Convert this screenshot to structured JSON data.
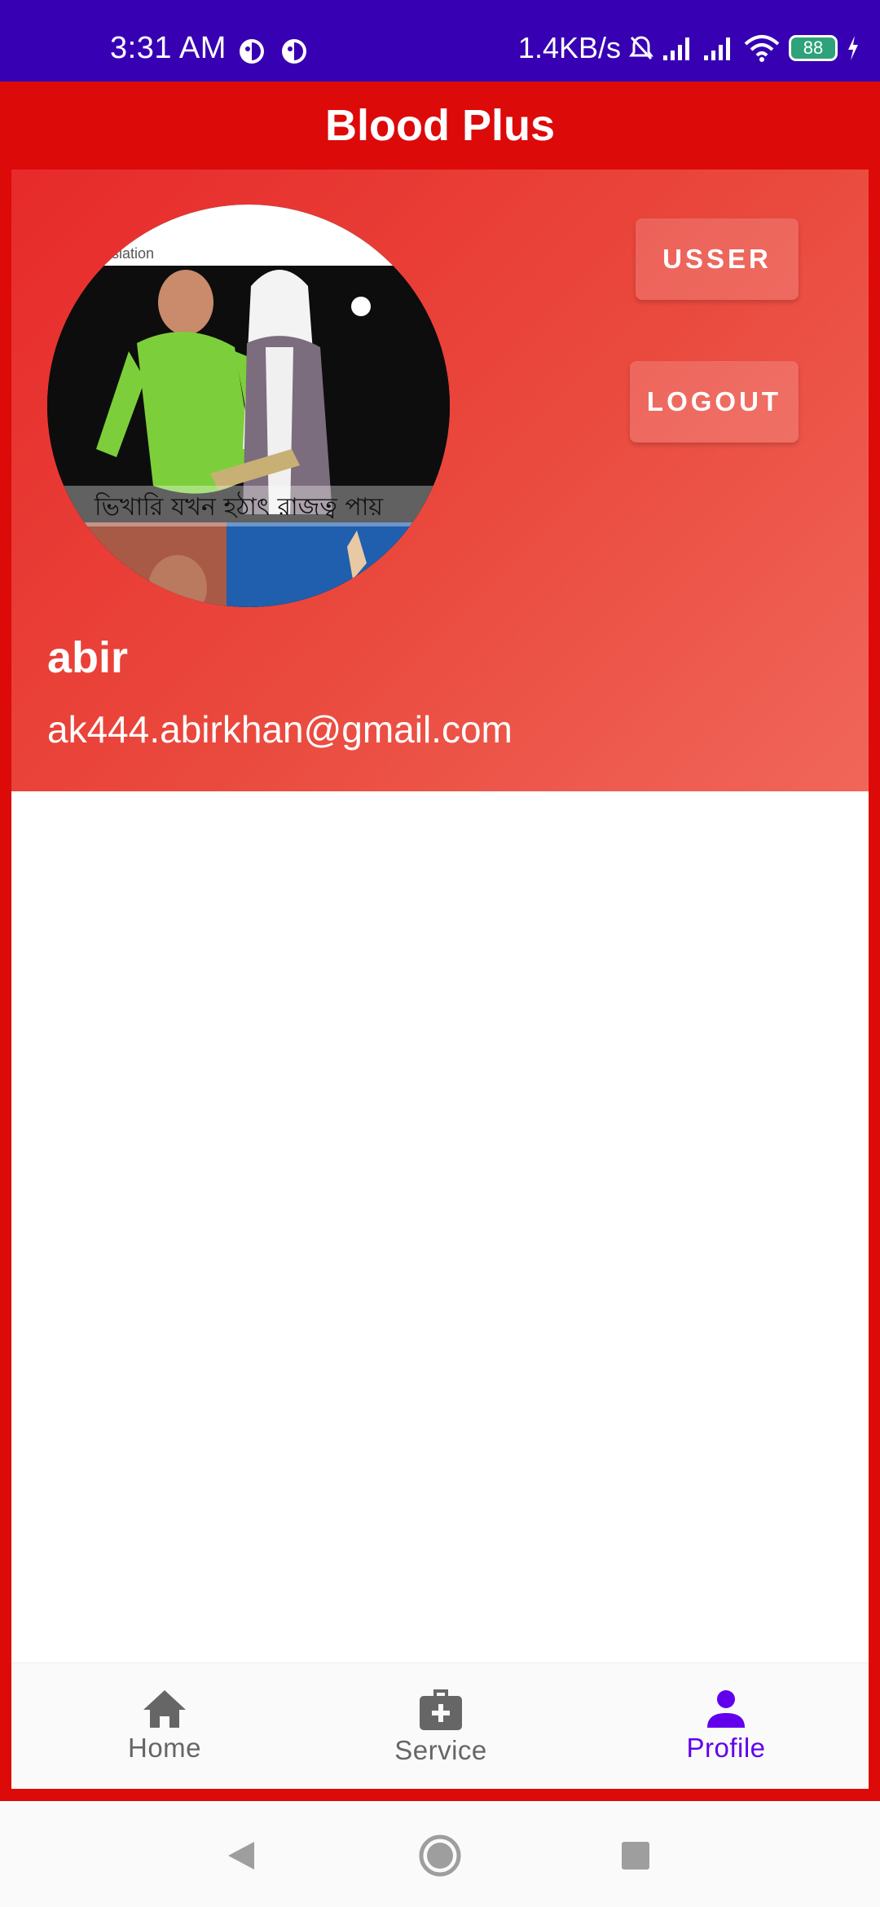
{
  "status_bar": {
    "time": "3:31 AM",
    "network_speed": "1.4KB/s",
    "battery": "88",
    "icons": [
      "notification-icon",
      "notification-icon",
      "mute-icon",
      "signal-icon",
      "signal-icon",
      "wifi-icon",
      "battery-icon",
      "charging-icon"
    ]
  },
  "app": {
    "title": "Blood Plus"
  },
  "profile": {
    "name": "abir",
    "email": "ak444.abirkhan@gmail.com",
    "avatar_caption": "ভিখারি যখন হঠাৎ রাজত্ব পায়",
    "avatar_watermark": "islation",
    "usser_button": "USSER",
    "logout_button": "LOGOUT"
  },
  "bottom_nav": {
    "items": [
      {
        "label": "Home",
        "icon": "home-icon",
        "active": false
      },
      {
        "label": "Service",
        "icon": "medical-bag-icon",
        "active": false
      },
      {
        "label": "Profile",
        "icon": "person-icon",
        "active": true
      }
    ]
  },
  "colors": {
    "status_bar": "#3700b3",
    "app_bar": "#dd0a0a",
    "accent": "#6200ee",
    "inactive": "#666666"
  }
}
